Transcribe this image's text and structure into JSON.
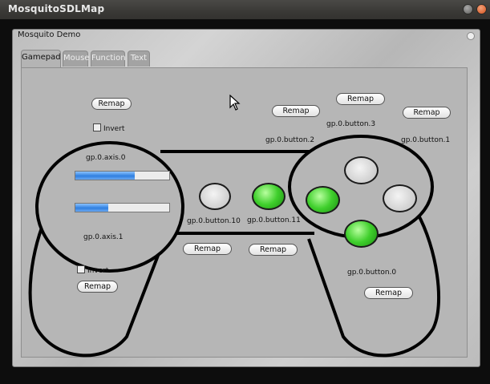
{
  "window": {
    "title": "MosquitoSDLMap"
  },
  "panel": {
    "title": "Mosquito Demo"
  },
  "tabs": [
    {
      "label": "Gamepad",
      "active": true
    },
    {
      "label": "Mouse",
      "active": false
    },
    {
      "label": "Function",
      "active": false
    },
    {
      "label": "Text",
      "active": false
    }
  ],
  "gamepad": {
    "remap_label": "Remap",
    "invert_label": "Invert",
    "axis0": {
      "label": "gp.0.axis.0",
      "level": 0.63
    },
    "axis1": {
      "label": "gp.0.axis.1",
      "level": 0.35
    },
    "buttons": {
      "b0": {
        "label": "gp.0.button.0",
        "pressed": true
      },
      "b1": {
        "label": "gp.0.button.1",
        "pressed": false
      },
      "b2": {
        "label": "gp.0.button.2",
        "pressed": true
      },
      "b3": {
        "label": "gp.0.button.3",
        "pressed": false
      },
      "b10": {
        "label": "gp.0.button.10",
        "pressed": false
      },
      "b11": {
        "label": "gp.0.button.11",
        "pressed": true
      }
    }
  },
  "colors": {
    "led_on": "#3fcf2c",
    "progress": "#2f7fe0"
  }
}
